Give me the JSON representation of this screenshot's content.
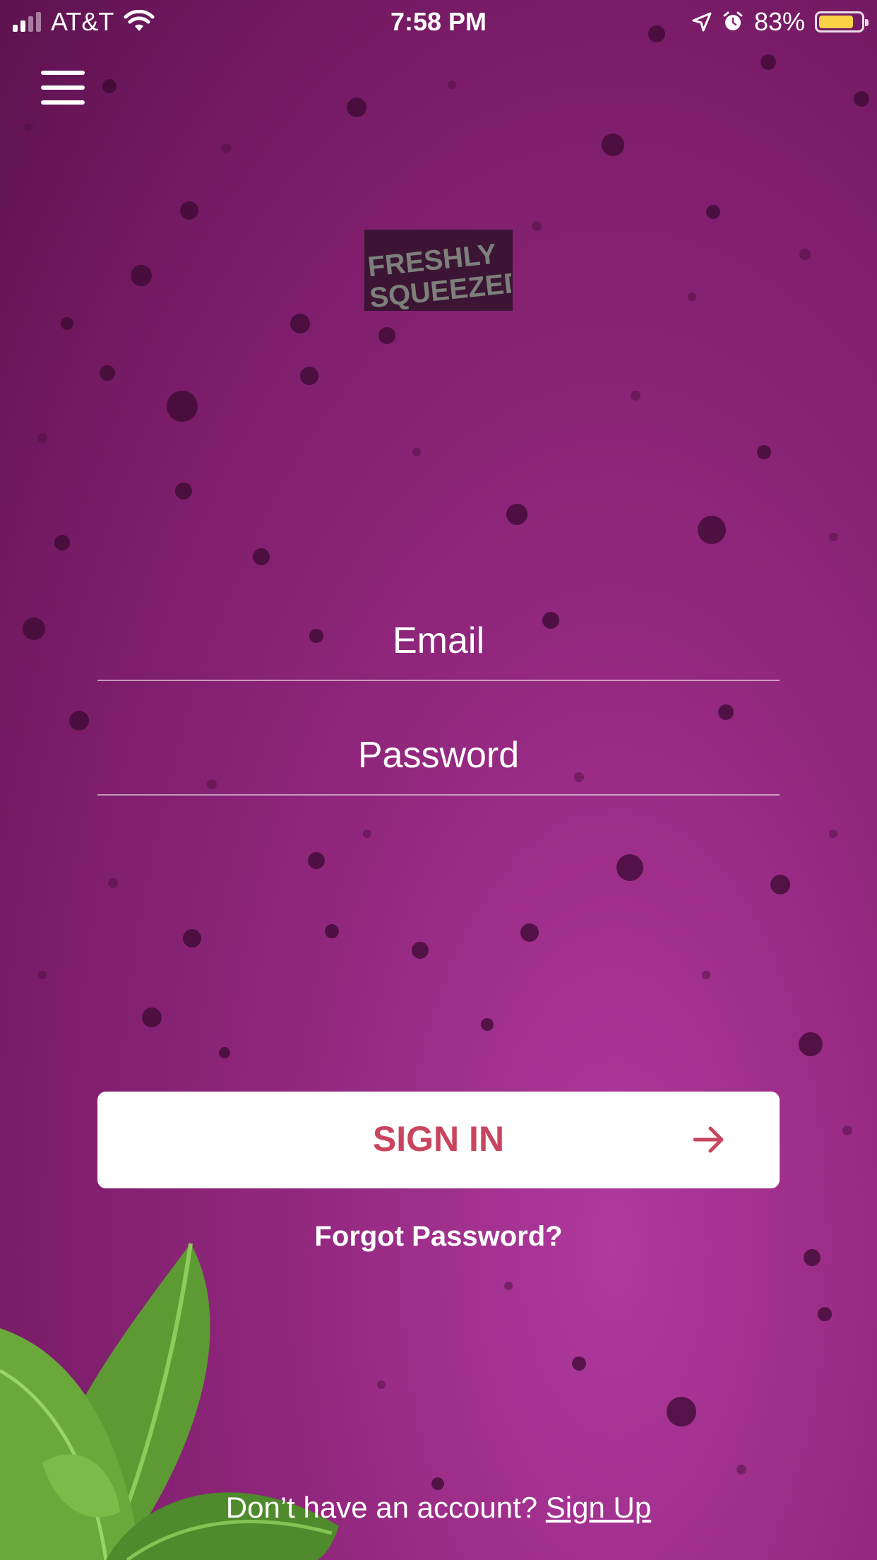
{
  "status_bar": {
    "carrier": "AT&T",
    "time": "7:58 PM",
    "battery_percent": "83%",
    "battery_level": 0.83,
    "icons": [
      "signal-icon",
      "wifi-icon",
      "location-icon",
      "alarm-icon",
      "battery-icon"
    ]
  },
  "header": {
    "menu_icon": "hamburger-menu-icon"
  },
  "logo": {
    "line1": "FRESHLY",
    "line2": "SQUEEZED"
  },
  "form": {
    "email_placeholder": "Email",
    "password_placeholder": "Password",
    "email_value": "",
    "password_value": ""
  },
  "actions": {
    "sign_in_label": "SIGN IN",
    "sign_in_icon": "arrow-right-icon",
    "forgot_password": "Forgot Password?",
    "signup_prompt": "Don’t have an account?",
    "signup_link": "Sign Up"
  },
  "colors": {
    "background": "#93287f",
    "button_text": "#c9455f",
    "battery_fill": "#f9d246",
    "leaf": "#6aa83c"
  }
}
